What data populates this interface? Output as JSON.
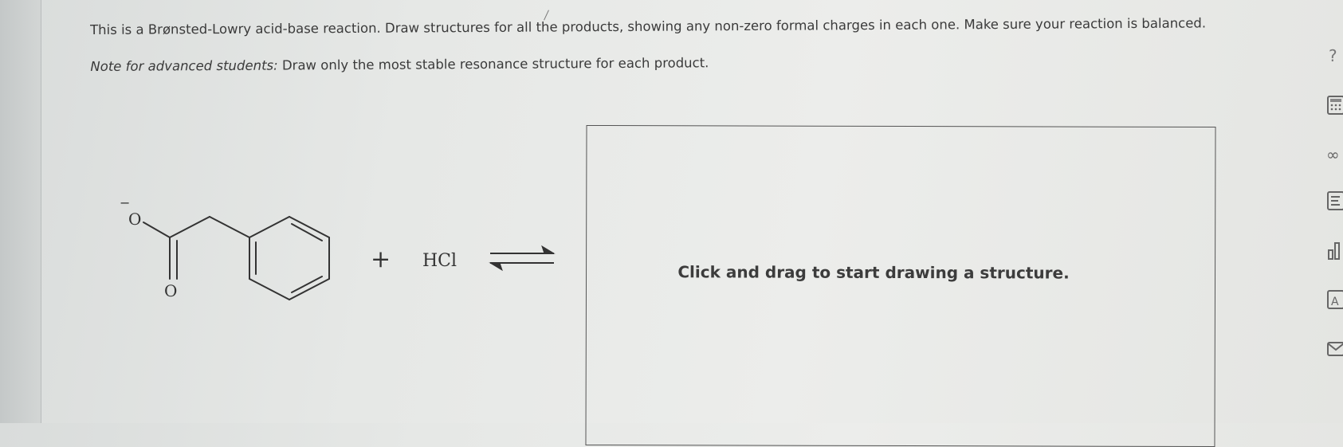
{
  "instructions": {
    "main": "This is a Brønsted-Lowry acid-base reaction. Draw structures for all the products, showing any non-zero formal charges in each one. Make sure your reaction is balanced.",
    "note_label": "Note for advanced students:",
    "note_text": "Draw only the most stable resonance structure for each product."
  },
  "reaction": {
    "reactant1": {
      "oxygen_top": "O",
      "oxygen_bottom": "O",
      "charge": "−"
    },
    "plus": "+",
    "reactant2": "HCl"
  },
  "drawing_area": {
    "prompt": "Click and drag to start drawing a structure."
  },
  "toolbar": [
    {
      "name": "help-tool-icon",
      "glyph": "?"
    },
    {
      "name": "calculator-tool-icon",
      "glyph": "calc"
    },
    {
      "name": "link-tool-icon",
      "glyph": "∞"
    },
    {
      "name": "reference-tool-icon",
      "glyph": "E"
    },
    {
      "name": "chart-tool-icon",
      "glyph": "bars"
    },
    {
      "name": "text-tool-icon",
      "glyph": "A"
    },
    {
      "name": "mail-tool-icon",
      "glyph": "mail"
    }
  ]
}
